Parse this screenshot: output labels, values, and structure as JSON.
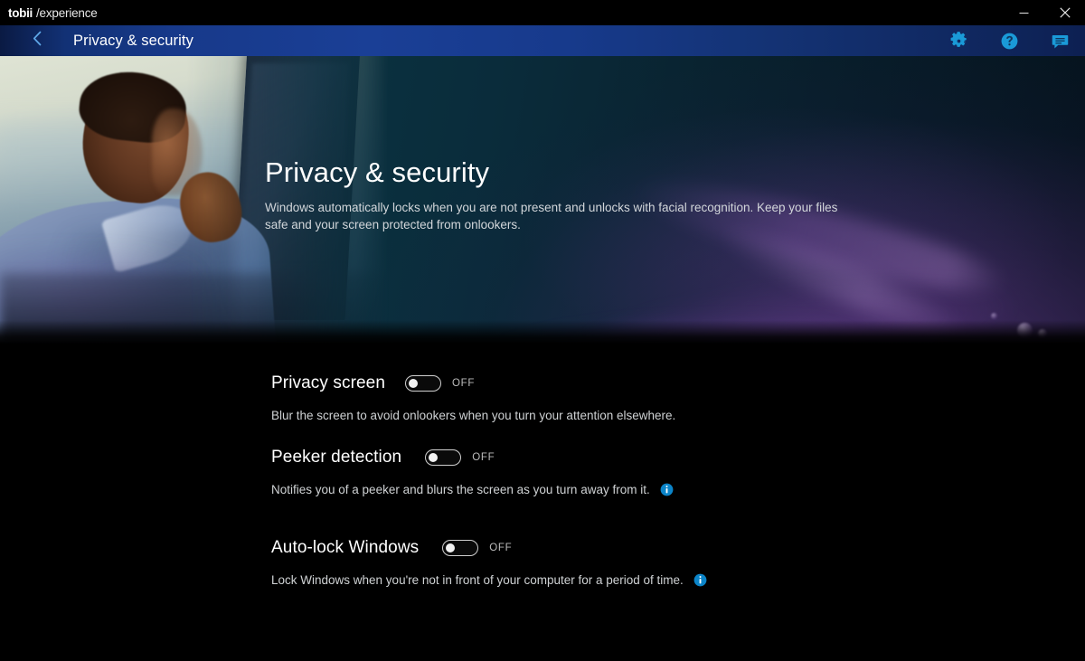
{
  "window": {
    "brand_main": "tobii",
    "brand_sub": "/experience",
    "minimize_label": "Minimize",
    "close_label": "Close"
  },
  "navbar": {
    "back_label": "Back",
    "title": "Privacy & security",
    "actions": [
      {
        "name": "settings",
        "icon": "gear-icon",
        "label": "Settings"
      },
      {
        "name": "help",
        "icon": "help-circle-icon",
        "label": "Help"
      },
      {
        "name": "feedback",
        "icon": "chat-bubble-icon",
        "label": "Feedback"
      }
    ]
  },
  "hero": {
    "title": "Privacy & security",
    "description": "Windows automatically locks when you are not present and unlocks with facial recognition. Keep your files safe and your screen protected from onlookers."
  },
  "settings": {
    "rows": [
      {
        "label": "Privacy screen",
        "state": "OFF",
        "enabled": false,
        "description": "Blur the screen to avoid onlookers when you turn your attention elsewhere.",
        "has_info": false
      },
      {
        "label": "Peeker detection",
        "state": "OFF",
        "enabled": false,
        "description": "Notifies you of a peeker and blurs the screen as you turn away from it.",
        "has_info": true
      },
      {
        "label": "Auto-lock Windows",
        "state": "OFF",
        "enabled": false,
        "description": "Lock Windows when you're not in front of your computer for a period of time.",
        "has_info": true
      }
    ]
  },
  "colors": {
    "accent_blue": "#0a84c8",
    "nav_blue": "#1a3f96",
    "back_chevron": "#5fa8e8",
    "page_background": "#000000",
    "icon_blue": "#1a9ad8"
  }
}
